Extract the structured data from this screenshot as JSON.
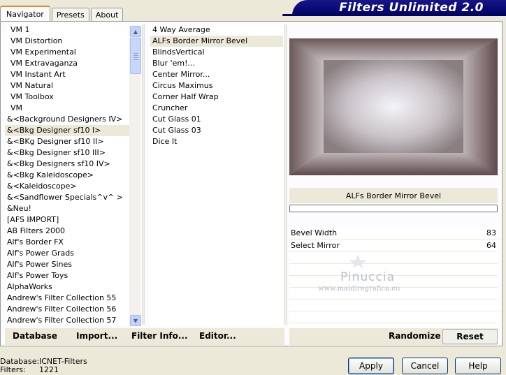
{
  "tabs": [
    "Navigator",
    "Presets",
    "About"
  ],
  "app_title": "Filters Unlimited 2.0",
  "categories": [
    "VM 1",
    "VM Distortion",
    "VM Experimental",
    "VM Extravaganza",
    "VM Instant Art",
    "VM Natural",
    "VM Toolbox",
    "VM",
    "&<Background Designers IV>",
    "&<Bkg Designer sf10 I>",
    "&<BKg Designer sf10 II>",
    "&<Bkg Designer sf10 III>",
    "&<Bkg Designers sf10 IV>",
    "&<Bkg Kaleidoscope>",
    "&<Kaleidoscope>",
    "&<Sandflower Specials^v^ >",
    "&Neu!",
    "[AFS IMPORT]",
    "AB Filters 2000",
    "Alf's Border FX",
    "Alf's Power Grads",
    "Alf's Power Sines",
    "Alf's Power Toys",
    "AlphaWorks",
    "Andrew's Filter Collection 55",
    "Andrew's Filter Collection 56",
    "Andrew's Filter Collection 57"
  ],
  "filters": [
    "4 Way Average",
    "ALFs Border Mirror Bevel",
    "BlindsVertical",
    "Blur 'em!...",
    "Center Mirror...",
    "Circus Maximus",
    "Corner Half Wrap",
    "Cruncher",
    "Cut Glass 01",
    "Cut Glass 03",
    "Dice It"
  ],
  "selected_filter_name": "ALFs Border Mirror Bevel",
  "params": [
    {
      "label": "Bevel Width",
      "value": "83"
    },
    {
      "label": "Select Mirror",
      "value": "64"
    }
  ],
  "watermark": {
    "title": "Pinuccia",
    "url": "www.maidiregrafica.eu"
  },
  "toolbar": {
    "database": "Database",
    "import": "Import...",
    "filter_info": "Filter Info...",
    "editor": "Editor...",
    "randomize": "Randomize",
    "reset": "Reset"
  },
  "footer": {
    "database_label": "Database:",
    "database_value": "ICNET-Filters",
    "filters_label": "Filters:",
    "filters_value": "1221"
  },
  "buttons": {
    "apply": "Apply",
    "cancel": "Cancel",
    "help": "Help"
  }
}
